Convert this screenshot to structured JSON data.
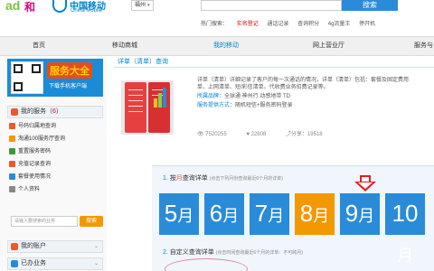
{
  "header": {
    "city": "福州",
    "search_button": "搜索",
    "hot_label": "热门搜索：",
    "hot_links": [
      "实名登记",
      "通话记录",
      "查询积分",
      "4g流量王",
      "停开机"
    ]
  },
  "logo": {
    "brand_cn": "中国移动",
    "brand_en": "China Mobile"
  },
  "nav": [
    "首页",
    "移动商城",
    "我的移动",
    "网上营业厅",
    "服务与"
  ],
  "nav_active_index": 2,
  "sidebar": {
    "banner_title": "服务大全",
    "banner_sub": "下载手机客户端",
    "my_services_label": "我的服务",
    "my_services_count": "6",
    "services": [
      {
        "label": "号码归属地查询",
        "color": "#e85b2d"
      },
      {
        "label": "淘通100服务厅查询",
        "color": "#f39800"
      },
      {
        "label": "重置服务密码",
        "color": "#3a9a3a"
      },
      {
        "label": "充值记录查询",
        "color": "#e85b2d"
      },
      {
        "label": "套餐使用情况",
        "color": "#2a8bd8"
      },
      {
        "label": "个人资料",
        "color": "#888888"
      }
    ],
    "search_placeholder": "请输入要搜索的业务",
    "search_button": "搜索",
    "accounts": [
      {
        "label": "我的账户",
        "color": "#e85b2d"
      },
      {
        "label": "已办业务",
        "color": "#2a8bd8"
      }
    ]
  },
  "main": {
    "title": "详单（清单）查询",
    "desc_1": "详单（清单）详细记录了客户的每一次通话的情况，详单（清单）包括：套餐及固定费用",
    "desc_2": "单、上网清单、短/彩信清单、代收费业务扣费记录等。",
    "brand_label": "所属品牌：",
    "brand_value": "全球通 神州行 动感地带 TD",
    "method_label": "服务提供方式：",
    "method_value": "随机短信+服务密码登录",
    "stat_views": "7520255",
    "stat_likes": "22808",
    "stat_shares": "19518",
    "step1_num": "1.",
    "step1_text": "按",
    "step1_hl": "月",
    "step1_text2": "查询详单",
    "step1_note": "(点击下列月份查询最近6个月的详单)",
    "step2_num": "2.",
    "step2_text": "自定义查询详单",
    "step2_note": "(点击时间查询最近6个月的详单：不可跨月)",
    "months": [
      "5",
      "6",
      "7",
      "8",
      "9",
      "10"
    ],
    "month_unit": "月",
    "month_colors": [
      "#2a8bd8",
      "#2a8bd8",
      "#2a8bd8",
      "#f39800",
      "#2a8bd8",
      "#2a8bd8"
    ]
  }
}
